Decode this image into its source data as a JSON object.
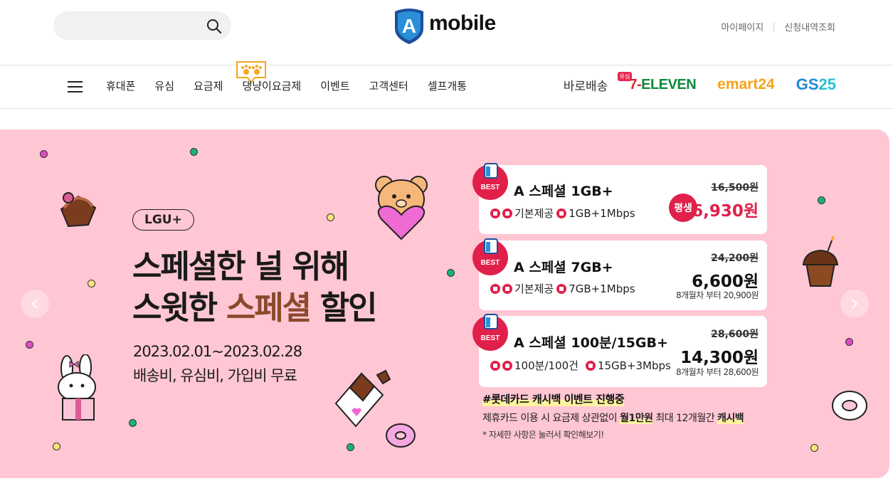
{
  "header": {
    "search": {
      "placeholder": "",
      "icon": "search-icon"
    },
    "logo": {
      "badge": "A",
      "text": "mobile"
    },
    "util_links": [
      "마이페이지",
      "신청내역조회"
    ]
  },
  "nav": {
    "menu": [
      "휴대폰",
      "유심",
      "요금제",
      "댕냥이요금제",
      "이벤트",
      "고객센터",
      "셀프개통"
    ],
    "partners": {
      "baro": "바로배송",
      "baro_badge": "유심",
      "seven_a": "7-",
      "seven_b": "ELEVEN",
      "emart": "emart24",
      "gs_a": "GS",
      "gs_b": "25"
    }
  },
  "banner": {
    "background": "#ffc6d4",
    "carrier": "LGU+",
    "headline_line1": "스페셜한 널 위해",
    "headline_line2_a": "스윗한 ",
    "headline_line2_b": "스페셜",
    "headline_line2_c": " 할인",
    "period": "2023.02.01~2023.02.28",
    "fees": "배송비, 유심비, 가입비 무료",
    "plans": [
      {
        "badge": "BEST",
        "name": "A 스페셜 1GB+",
        "features": "기본제공",
        "data": "1GB+1Mbps",
        "old_price": "16,500원",
        "tag": "평생",
        "price": "6,930원",
        "note": ""
      },
      {
        "badge": "BEST",
        "name": "A 스페셜 7GB+",
        "features": "기본제공",
        "data": "7GB+1Mbps",
        "old_price": "24,200원",
        "tag": "",
        "price": "6,600원",
        "note": "8개월차 부터 20,900원"
      },
      {
        "badge": "BEST",
        "name": "A 스페셜 100분/15GB+",
        "features": "100분/100건",
        "data": "15GB+3Mbps",
        "old_price": "28,600원",
        "tag": "",
        "price": "14,300원",
        "note": "8개월차 부터 28,600원"
      }
    ],
    "promo": {
      "title": "#롯데카드 캐시백 이벤트 진행중",
      "line_a": "제휴카드 이용 시 요금제 상관없이 ",
      "line_b": "월1만원",
      "line_c": " 최대 12개월간 ",
      "line_d": "캐시백",
      "note": "* 자세한 사항은 눌러서 확인해보기!"
    },
    "colors": {
      "accent": "#e0204a",
      "highlight": "#8a4a2b"
    }
  }
}
